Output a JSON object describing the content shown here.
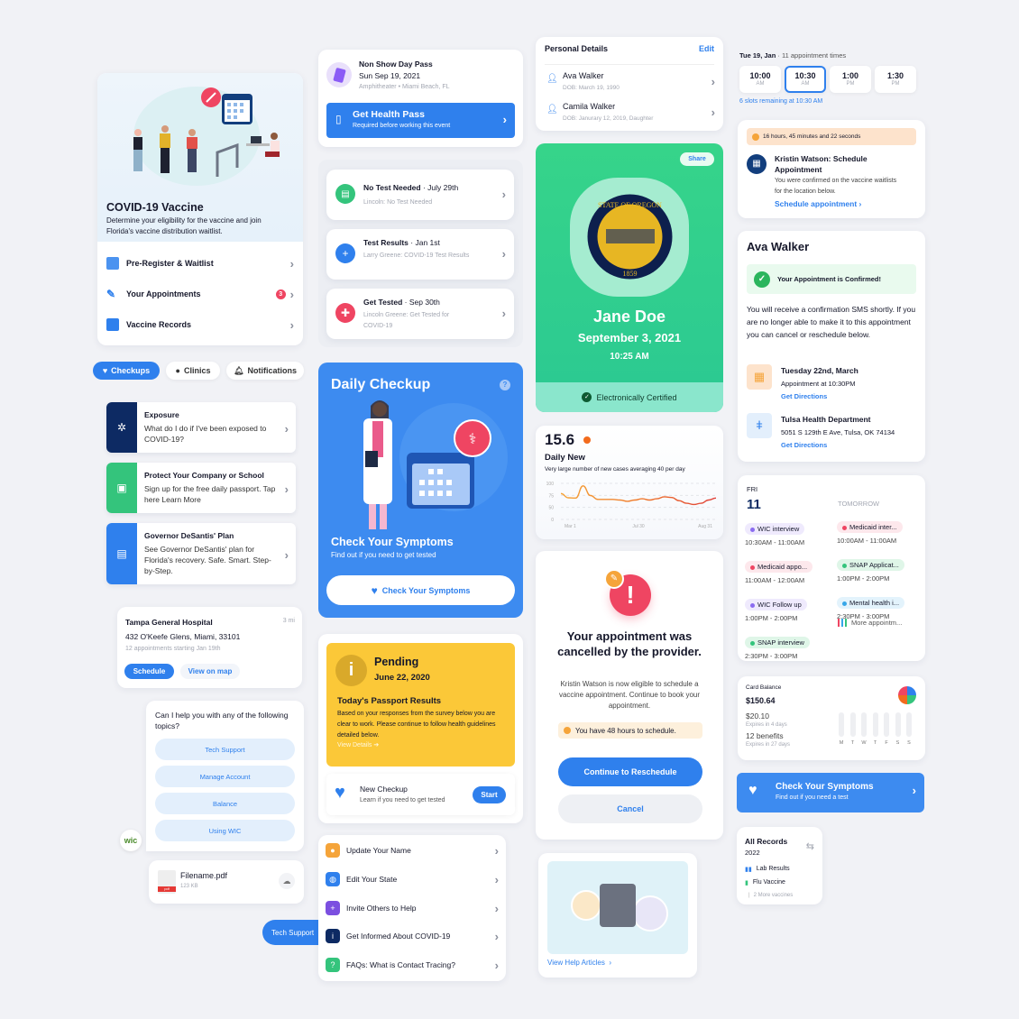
{
  "vaccine_card": {
    "title": "COVID-19 Vaccine",
    "description": "Determine your eligibility for the vaccine and join Florida's vaccine distribution waitlist.",
    "items": [
      {
        "label": "Pre-Register & Waitlist",
        "icon": "calendar-icon"
      },
      {
        "label": "Your Appointments",
        "icon": "syringe-icon",
        "badge": "3"
      },
      {
        "label": "Vaccine Records",
        "icon": "record-icon"
      }
    ]
  },
  "tabs": [
    {
      "label": "Checkups",
      "icon": "heart-icon",
      "active": true
    },
    {
      "label": "Clinics",
      "icon": "pin-icon",
      "active": false
    },
    {
      "label": "Notifications",
      "icon": "bell-icon",
      "active": false
    }
  ],
  "info_cards": [
    {
      "title": "Exposure",
      "desc": "What do I do if I've been exposed to COVID-19?",
      "color": "#0d2a63",
      "icon": "virus-icon"
    },
    {
      "title": "Protect Your Company or School",
      "desc": "Sign up for the free daily passport. Tap here Learn More",
      "color": "#34c47c",
      "icon": "passport-icon"
    },
    {
      "title": "Governor DeSantis' Plan",
      "desc": "See Governor DeSantis' plan for Florida's recovery. Safe. Smart. Step-by-Step.",
      "color": "#2f80ed",
      "icon": "plan-icon"
    }
  ],
  "hospital": {
    "name": "Tampa General Hospital",
    "distance": "3 mi",
    "address": "432 O'Keefe Glens, Miami, 33101",
    "appointments": "12 appointments starting Jan 19th",
    "schedule_label": "Schedule",
    "map_label": "View on map"
  },
  "chat": {
    "prompt": "Can I help you with any of the following topics?",
    "topics": [
      "Tech Support",
      "Manage Account",
      "Balance",
      "Using WIC"
    ],
    "avatar": "wic",
    "file_name": "Filename.pdf",
    "file_size": "123 KB",
    "file_type": "pdf",
    "user_message": "Tech Support"
  },
  "day_pass": {
    "title": "Non Show Day Pass",
    "date": "Sun Sep 19, 2021",
    "location": "Amphitheater • Miami Beach, FL",
    "button_title": "Get Health Pass",
    "button_sub": "Required before working this event"
  },
  "tests": [
    {
      "title": "No Test Needed",
      "date": "July 29th",
      "sub": "Lincoln: No Test Needed",
      "color": "#34c47c"
    },
    {
      "title": "Test Results",
      "date": "Jan 1st",
      "sub": "Larry Greene: COVID-19 Test Results",
      "color": "#2f80ed"
    },
    {
      "title": "Get Tested",
      "date": "Sep 30th",
      "sub": "Lincoln Greene: Get Tested for COVID-19",
      "color": "#ef4562"
    }
  ],
  "daily_checkup": {
    "title": "Daily Checkup",
    "help": "?",
    "headline": "Check Your Symptoms",
    "sub": "Find out if you need to get tested",
    "button": "Check Your Symptoms"
  },
  "pending": {
    "status": "Pending",
    "date": "June 22, 2020",
    "heading": "Today's Passport Results",
    "body": "Based on your responses from the survey below you are clear to work. Please continue to follow health guidelines detailed below.",
    "link": "View Details",
    "checkup_title": "New Checkup",
    "checkup_sub": "Learn if you need to get tested",
    "start": "Start"
  },
  "settings": [
    {
      "label": "Update Your Name",
      "color": "#f5a43a"
    },
    {
      "label": "Edit Your State",
      "color": "#2f80ed"
    },
    {
      "label": "Invite Others to Help",
      "color": "#7b4fe0"
    },
    {
      "label": "Get Informed About COVID-19",
      "color": "#0d2a63"
    },
    {
      "label": "FAQs: What is Contact Tracing?",
      "color": "#34c47c"
    }
  ],
  "personal": {
    "title": "Personal Details",
    "edit": "Edit",
    "people": [
      {
        "name": "Ava Walker",
        "dob": "DOB: March 19, 1990"
      },
      {
        "name": "Camila Walker",
        "dob": "DOB: Janurary 12, 2019, Daughter"
      }
    ]
  },
  "certificate": {
    "share": "Share",
    "seal_top": "STATE OF OREGON",
    "seal_year": "1859",
    "name": "Jane Doe",
    "date": "September 3, 2021",
    "time": "10:25 AM",
    "status": "Electronically Certified"
  },
  "daily_new": {
    "value": "15.6",
    "title": "Daily New",
    "desc": "Very large number of new cases averaging 40 per day"
  },
  "chart_data": {
    "type": "line",
    "title": "Daily New",
    "x_labels": [
      "Mar 1",
      "Jul 30",
      "Aug 31"
    ],
    "y_ticks": [
      "100",
      "75",
      "50",
      "0"
    ],
    "ylim": [
      0,
      100
    ],
    "values": [
      68,
      55,
      54,
      92,
      62,
      50,
      50,
      50,
      48,
      44,
      48,
      52,
      48,
      52,
      58,
      56,
      46,
      38,
      34,
      38,
      48,
      54
    ],
    "grid": true
  },
  "cancelled": {
    "title": "Your appointment was cancelled by the provider.",
    "body": "Kristin Watson is now eligible to schedule a vaccine appointment. Continue to book your appointment.",
    "warning": "You have 48 hours to schedule.",
    "primary": "Continue to Reschedule",
    "secondary": "Cancel"
  },
  "help_articles": {
    "link": "View Help Articles"
  },
  "slots": {
    "date": "Tue 19, Jan",
    "count": "11 appointment times",
    "times": [
      {
        "time": "10:00",
        "period": "AM",
        "selected": false
      },
      {
        "time": "10:30",
        "period": "AM",
        "selected": true
      },
      {
        "time": "1:00",
        "period": "PM",
        "selected": false
      },
      {
        "time": "1:30",
        "period": "PM",
        "selected": false
      }
    ],
    "remaining": "6 slots remaining at 10:30 AM"
  },
  "schedule_notice": {
    "timer": "16 hours, 45 minutes and 22 seconds",
    "title": "Kristin Watson: Schedule Appointment",
    "body": "You were confirmed on the vaccine waitlists for the location below.",
    "link": "Schedule appointment"
  },
  "confirmation": {
    "name": "Ava Walker",
    "banner": "Your Appointment is Confirmed!",
    "body": "You will receive a confirmation SMS shortly. If you are no longer able to make it to this appointment you can cancel or reschedule below.",
    "date_title": "Tuesday 22nd, March",
    "date_sub": "Appointment at 10:30PM",
    "loc_title": "Tulsa Health Department",
    "loc_sub": "5051 S 129th E Ave, Tulsa, OK 74134",
    "directions": "Get Directions"
  },
  "agenda": {
    "day": "FRI",
    "date": "11",
    "tomorrow": "TOMORROW",
    "today_events": [
      {
        "label": "WIC interview",
        "time": "10:30AM - 11:00AM",
        "color": "#8b6cf0",
        "bg": "#efeafd"
      },
      {
        "label": "Medicaid appo...",
        "time": "11:00AM - 12:00AM",
        "color": "#ef4562",
        "bg": "#fde8ec"
      },
      {
        "label": "WIC Follow up",
        "time": "1:00PM - 2:00PM",
        "color": "#8b6cf0",
        "bg": "#efeafd"
      },
      {
        "label": "SNAP interview",
        "time": "2:30PM - 3:00PM",
        "color": "#34c47c",
        "bg": "#dff6e8"
      }
    ],
    "tomorrow_events": [
      {
        "label": "Medicaid inter...",
        "time": "10:00AM - 11:00AM",
        "color": "#ef4562",
        "bg": "#fde8ec"
      },
      {
        "label": "SNAP Applicat...",
        "time": "1:00PM - 2:00PM",
        "color": "#34c47c",
        "bg": "#dff6e8"
      },
      {
        "label": "Mental health i...",
        "time": "2:30PM - 3:00PM",
        "color": "#36a6e8",
        "bg": "#e3f3fc"
      }
    ],
    "more": "More appointm..."
  },
  "balance": {
    "label": "Card Balance",
    "amount": "$150.64",
    "sub_amount": "$20.10",
    "sub_expires": "Expires in 4 days",
    "benefits": "12 benefits",
    "benefits_expires": "Expires in 27 days",
    "days": [
      "M",
      "T",
      "W",
      "T",
      "F",
      "S",
      "S"
    ]
  },
  "symptoms_banner": {
    "title": "Check Your Symptoms",
    "sub": "Find out if you need a test"
  },
  "records": {
    "title": "All Records",
    "year": "2022",
    "items": [
      "Lab Results",
      "Flu Vaccine"
    ],
    "more": "2 More vaccines"
  }
}
